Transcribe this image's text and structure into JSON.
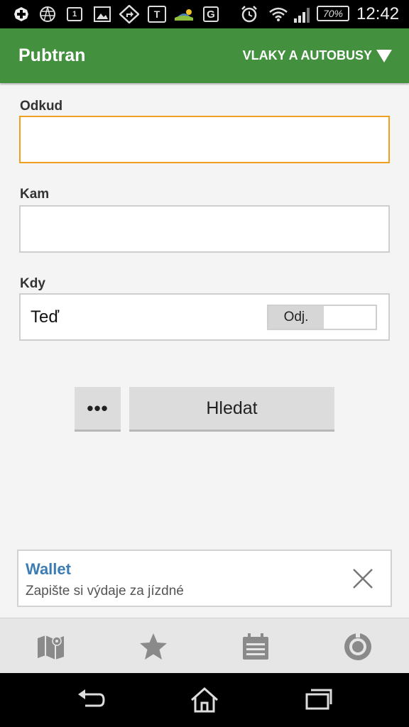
{
  "status_bar": {
    "calendar_day": "1",
    "t_badge": "T",
    "g_badge": "G",
    "battery": "70%",
    "time": "12:42",
    "icons": [
      "plus-icon",
      "network-icon",
      "calendar-icon",
      "image-icon",
      "maps-icon",
      "t-icon",
      "weather-icon",
      "g-icon",
      "alarm-icon",
      "wifi-icon",
      "signal-icon",
      "battery-icon"
    ]
  },
  "appbar": {
    "title": "Pubtran",
    "mode": "VLAKY A AUTOBUSY"
  },
  "form": {
    "from_label": "Odkud",
    "from_value": "",
    "to_label": "Kam",
    "to_value": "",
    "when_label": "Kdy",
    "when_value": "Teď",
    "toggle_label": "Odj."
  },
  "buttons": {
    "more": "•••",
    "search": "Hledat"
  },
  "banner": {
    "title": "Wallet",
    "subtitle": "Zapište si výdaje za jízdné"
  },
  "tabs": [
    "map-icon",
    "star-icon",
    "timetable-icon",
    "settings-icon"
  ],
  "colors": {
    "appbar": "#43913f",
    "focus_border": "#f0a020",
    "banner_title": "#3c7cb5"
  }
}
